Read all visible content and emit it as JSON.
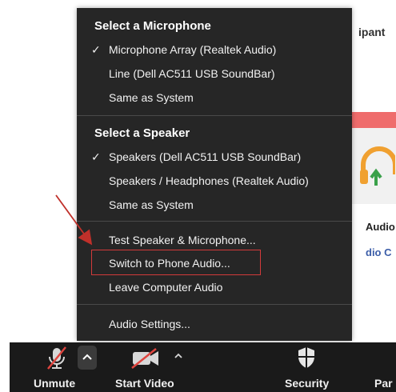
{
  "background": {
    "header_fragment": "ipant",
    "audio_fragment": "Audio",
    "audio_link_fragment": "dio C"
  },
  "menu": {
    "microphone_title": "Select a Microphone",
    "microphones": [
      {
        "label": "Microphone Array (Realtek Audio)",
        "checked": true
      },
      {
        "label": "Line (Dell AC511 USB SoundBar)",
        "checked": false
      },
      {
        "label": "Same as System",
        "checked": false
      }
    ],
    "speaker_title": "Select a Speaker",
    "speakers": [
      {
        "label": "Speakers (Dell AC511 USB SoundBar)",
        "checked": true
      },
      {
        "label": "Speakers / Headphones (Realtek Audio)",
        "checked": false
      },
      {
        "label": "Same as System",
        "checked": false
      }
    ],
    "actions": [
      {
        "label": "Test Speaker & Microphone..."
      },
      {
        "label": "Switch to Phone Audio..."
      },
      {
        "label": "Leave Computer Audio"
      }
    ],
    "settings_label": "Audio Settings...",
    "check_glyph": "✓"
  },
  "toolbar": {
    "unmute_label": "Unmute",
    "start_video_label": "Start Video",
    "security_label": "Security",
    "participants_fragment": "Par"
  },
  "colors": {
    "menu_bg": "#262626",
    "toolbar_bg": "#1a1a1a",
    "highlight_red": "#d33a3a",
    "icon_strike_red": "#e0453f"
  }
}
